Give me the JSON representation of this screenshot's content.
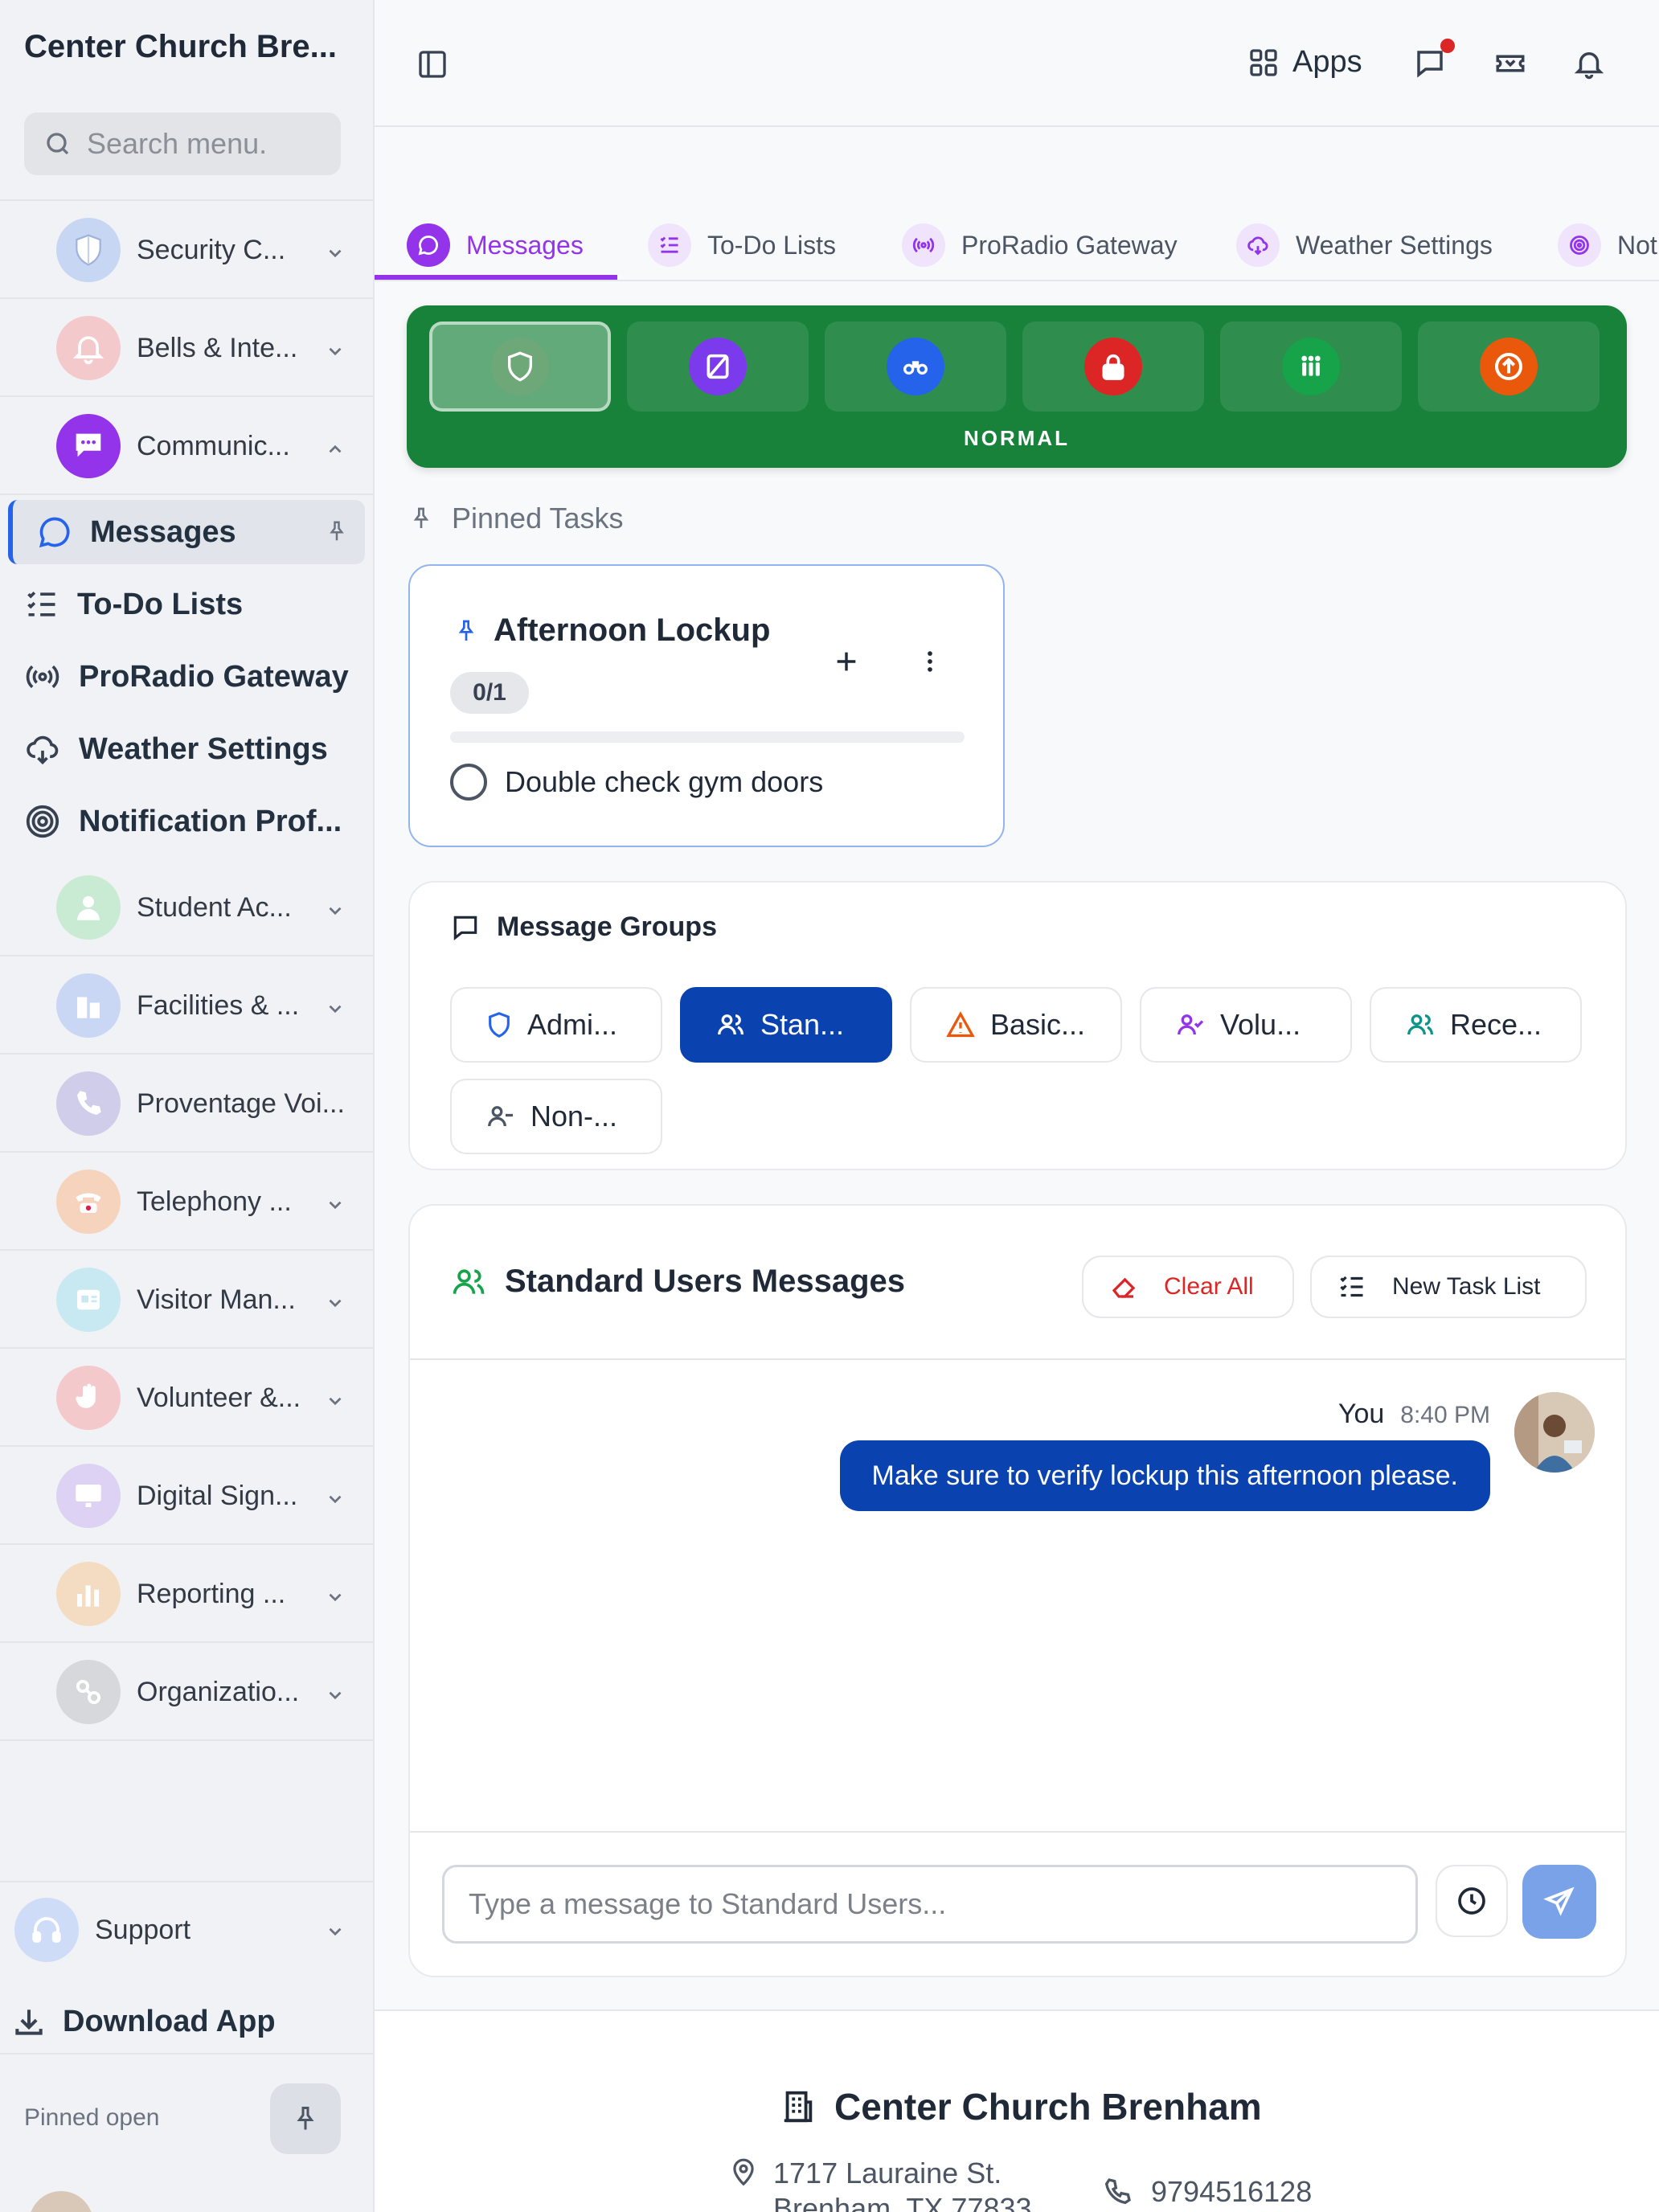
{
  "sidebar": {
    "org_title": "Center Church Bre...",
    "search_placeholder": "Search menu.",
    "categories": [
      {
        "label": "Security C...",
        "icon": "shield-icon",
        "color": "#c7d6f3"
      },
      {
        "label": "Bells & Inte...",
        "icon": "bell-icon",
        "color": "#f4c9cc"
      },
      {
        "label": "Communic...",
        "icon": "chat-icon",
        "color": "#9333ea"
      }
    ],
    "sub_items": [
      {
        "label": "Messages",
        "icon": "chat-bubble-icon"
      },
      {
        "label": "To-Do Lists",
        "icon": "checklist-icon"
      },
      {
        "label": "ProRadio Gateway",
        "icon": "radio-icon"
      },
      {
        "label": "Weather Settings",
        "icon": "cloud-icon"
      },
      {
        "label": "Notification Prof...",
        "icon": "target-icon"
      }
    ],
    "more_categories": [
      {
        "label": "Student Ac...",
        "icon": "student-icon",
        "color": "#c9ebd3",
        "chevron": true
      },
      {
        "label": "Facilities & ...",
        "icon": "building-icon",
        "color": "#c9d7f4",
        "chevron": true
      },
      {
        "label": "Proventage Voi...",
        "icon": "phone-icon",
        "color": "#cfcdea",
        "chevron": false
      },
      {
        "label": "Telephony ...",
        "icon": "telephone-icon",
        "color": "#f6d3bd",
        "chevron": true
      },
      {
        "label": "Visitor Man...",
        "icon": "badge-icon",
        "color": "#c8e9f2",
        "chevron": true
      },
      {
        "label": "Volunteer &...",
        "icon": "hand-icon",
        "color": "#f4c9cc",
        "chevron": true
      },
      {
        "label": "Digital Sign...",
        "icon": "monitor-icon",
        "color": "#ddd2f4",
        "chevron": true
      },
      {
        "label": "Reporting ...",
        "icon": "chart-icon",
        "color": "#f3dcc1",
        "chevron": true
      },
      {
        "label": "Organizatio...",
        "icon": "org-icon",
        "color": "#d6d8dc",
        "chevron": true
      }
    ],
    "support_label": "Support",
    "download_label": "Download App",
    "pinned_open_label": "Pinned open"
  },
  "header": {
    "apps_label": "Apps"
  },
  "tabs": [
    {
      "label": "Messages",
      "active": true
    },
    {
      "label": "To-Do Lists",
      "active": false
    },
    {
      "label": "ProRadio Gateway",
      "active": false
    },
    {
      "label": "Weather Settings",
      "active": false
    },
    {
      "label": "Not",
      "active": false
    }
  ],
  "status": {
    "label": "NORMAL",
    "bar_color": "#18823a",
    "buttons": [
      {
        "icon": "shield-icon",
        "color": "#6ea879",
        "selected": true
      },
      {
        "icon": "no-entry-icon",
        "color": "#7c3aed",
        "selected": false
      },
      {
        "icon": "binoculars-icon",
        "color": "#2563eb",
        "selected": false
      },
      {
        "icon": "lock-icon",
        "color": "#dc2626",
        "selected": false
      },
      {
        "icon": "people-icon",
        "color": "#16a34a",
        "selected": false
      },
      {
        "icon": "evacuate-icon",
        "color": "#ea580c",
        "selected": false
      }
    ]
  },
  "pinned_tasks": {
    "heading": "Pinned Tasks",
    "card": {
      "title": "Afternoon Lockup",
      "count": "0/1",
      "progress": 0,
      "items": [
        "Double check gym doors"
      ]
    }
  },
  "message_groups": {
    "title": "Message Groups",
    "chips": [
      {
        "label": "Admi...",
        "icon": "shield-icon",
        "icon_color": "#2563eb",
        "active": false
      },
      {
        "label": "Stan...",
        "icon": "users-icon",
        "icon_color": "#ffffff",
        "active": true
      },
      {
        "label": "Basic...",
        "icon": "warning-icon",
        "icon_color": "#ea580c",
        "active": false
      },
      {
        "label": "Volu...",
        "icon": "user-check-icon",
        "icon_color": "#9333ea",
        "active": false
      },
      {
        "label": "Rece...",
        "icon": "users-icon",
        "icon_color": "#0d9488",
        "active": false
      },
      {
        "label": "Non-...",
        "icon": "user-minus-icon",
        "icon_color": "#4b5563",
        "active": false
      }
    ]
  },
  "chat": {
    "title": "Standard Users Messages",
    "clear_label": "Clear All",
    "new_task_label": "New Task List",
    "messages": [
      {
        "author": "You",
        "time": "8:40 PM",
        "text": "Make sure to verify lockup this afternoon please."
      }
    ],
    "input_placeholder": "Type a message to Standard Users..."
  },
  "footer": {
    "name": "Center Church Brenham",
    "address_line1": "1717 Lauraine St.",
    "address_line2": "Brenham, TX 77833",
    "phone": "9794516128"
  }
}
